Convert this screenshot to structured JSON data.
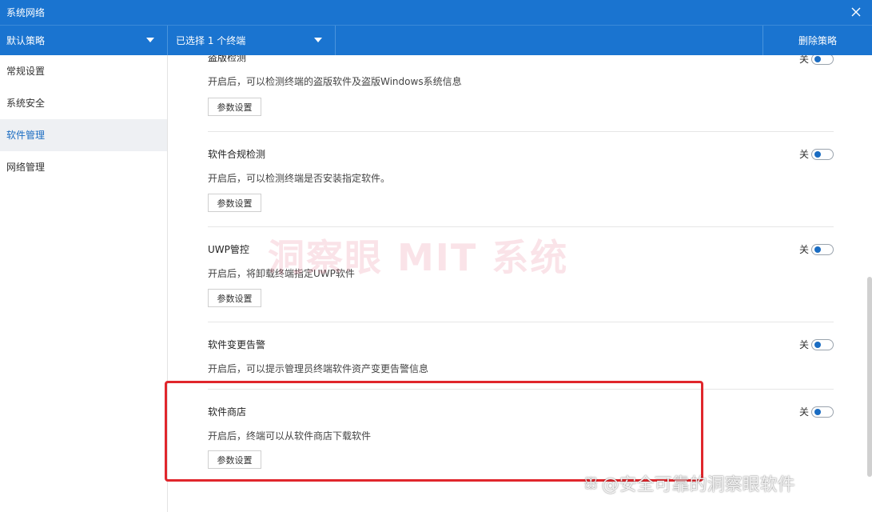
{
  "window": {
    "title": "系统网络"
  },
  "toolbar": {
    "policy_label": "默认策略",
    "endpoint_label": "已选择 1 个终端",
    "delete_label": "删除策略"
  },
  "sidebar": {
    "items": [
      {
        "label": "常规设置",
        "active": false
      },
      {
        "label": "系统安全",
        "active": false
      },
      {
        "label": "软件管理",
        "active": true
      },
      {
        "label": "网络管理",
        "active": false
      }
    ]
  },
  "sections": [
    {
      "title": "盗版检测",
      "desc": "开启后，可以检测终端的盗版软件及盗版Windows系统信息",
      "button": "参数设置",
      "toggle_label": "关",
      "enabled": false
    },
    {
      "title": "软件合规检测",
      "desc": "开启后，可以检测终端是否安装指定软件。",
      "button": "参数设置",
      "toggle_label": "关",
      "enabled": false
    },
    {
      "title": "UWP管控",
      "desc": "开启后，将卸载终端指定UWP软件",
      "button": "参数设置",
      "toggle_label": "关",
      "enabled": false
    },
    {
      "title": "软件变更告警",
      "desc": "开启后，可以提示管理员终端软件资产变更告警信息",
      "toggle_label": "关",
      "enabled": false
    },
    {
      "title": "软件商店",
      "desc": "开启后，终端可以从软件商店下载软件",
      "button": "参数设置",
      "toggle_label": "关",
      "enabled": false
    }
  ],
  "watermark": "洞察眼 MIT 系统",
  "credit": "@安全可靠的洞察眼软件",
  "colors": {
    "accent": "#1a74d0",
    "highlight": "#e0262c",
    "active_nav_text": "#1a6cc2"
  }
}
